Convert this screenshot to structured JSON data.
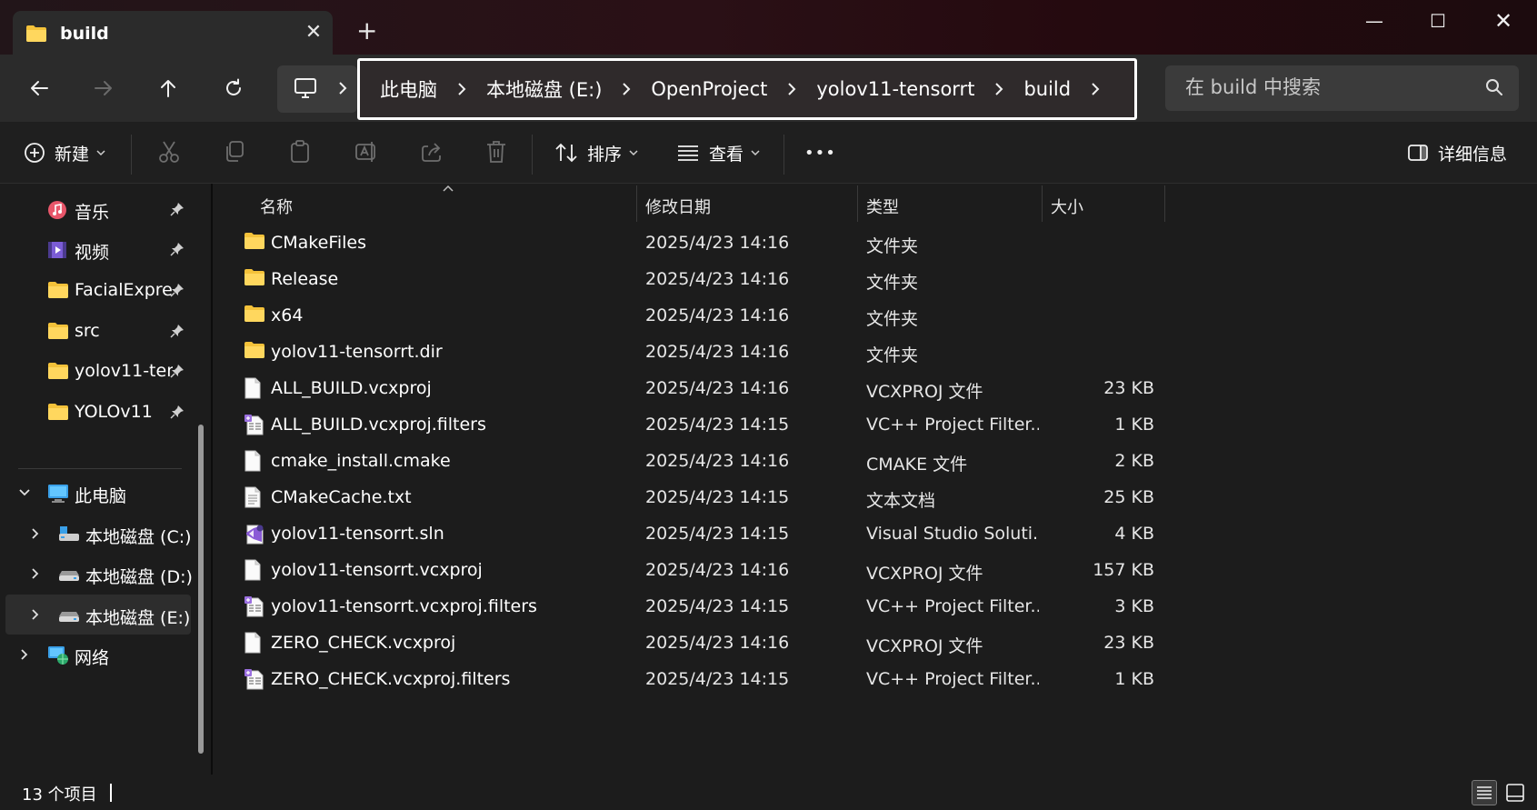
{
  "tab": {
    "title": "build",
    "close": "✕",
    "new": "+"
  },
  "window": {
    "minimize": "—",
    "maximize": "☐",
    "close": "✕"
  },
  "address": {
    "crumbs": [
      "此电脑",
      "本地磁盘 (E:)",
      "OpenProject",
      "yolov11-tensorrt",
      "build"
    ]
  },
  "search": {
    "placeholder": "在 build 中搜索"
  },
  "toolbar": {
    "new_label": "新建",
    "sort_label": "排序",
    "view_label": "查看",
    "more_label": "•••",
    "details_label": "详细信息"
  },
  "sidebar": {
    "quick_access": [
      {
        "label": "音乐",
        "icon": "music-icon"
      },
      {
        "label": "视频",
        "icon": "video-icon"
      },
      {
        "label": "FacialExpres",
        "icon": "folder-icon"
      },
      {
        "label": "src",
        "icon": "folder-icon"
      },
      {
        "label": "yolov11-ten",
        "icon": "folder-icon"
      },
      {
        "label": "YOLOv11",
        "icon": "folder-icon"
      }
    ],
    "this_pc": "此电脑",
    "drives": [
      "本地磁盘 (C:)",
      "本地磁盘 (D:)",
      "本地磁盘 (E:)"
    ],
    "network": "网络"
  },
  "columns": {
    "name": "名称",
    "date": "修改日期",
    "type": "类型",
    "size": "大小"
  },
  "files": [
    {
      "name": "CMakeFiles",
      "date": "2025/4/23 14:16",
      "type": "文件夹",
      "size": "",
      "icon": "folder"
    },
    {
      "name": "Release",
      "date": "2025/4/23 14:16",
      "type": "文件夹",
      "size": "",
      "icon": "folder"
    },
    {
      "name": "x64",
      "date": "2025/4/23 14:16",
      "type": "文件夹",
      "size": "",
      "icon": "folder"
    },
    {
      "name": "yolov11-tensorrt.dir",
      "date": "2025/4/23 14:16",
      "type": "文件夹",
      "size": "",
      "icon": "folder"
    },
    {
      "name": "ALL_BUILD.vcxproj",
      "date": "2025/4/23 14:16",
      "type": "VCXPROJ 文件",
      "size": "23 KB",
      "icon": "file"
    },
    {
      "name": "ALL_BUILD.vcxproj.filters",
      "date": "2025/4/23 14:15",
      "type": "VC++ Project Filter...",
      "size": "1 KB",
      "icon": "filters"
    },
    {
      "name": "cmake_install.cmake",
      "date": "2025/4/23 14:16",
      "type": "CMAKE 文件",
      "size": "2 KB",
      "icon": "file"
    },
    {
      "name": "CMakeCache.txt",
      "date": "2025/4/23 14:15",
      "type": "文本文档",
      "size": "25 KB",
      "icon": "text"
    },
    {
      "name": "yolov11-tensorrt.sln",
      "date": "2025/4/23 14:15",
      "type": "Visual Studio Soluti...",
      "size": "4 KB",
      "icon": "sln"
    },
    {
      "name": "yolov11-tensorrt.vcxproj",
      "date": "2025/4/23 14:16",
      "type": "VCXPROJ 文件",
      "size": "157 KB",
      "icon": "file"
    },
    {
      "name": "yolov11-tensorrt.vcxproj.filters",
      "date": "2025/4/23 14:15",
      "type": "VC++ Project Filter...",
      "size": "3 KB",
      "icon": "filters"
    },
    {
      "name": "ZERO_CHECK.vcxproj",
      "date": "2025/4/23 14:16",
      "type": "VCXPROJ 文件",
      "size": "23 KB",
      "icon": "file"
    },
    {
      "name": "ZERO_CHECK.vcxproj.filters",
      "date": "2025/4/23 14:15",
      "type": "VC++ Project Filter...",
      "size": "1 KB",
      "icon": "filters"
    }
  ],
  "status": {
    "count": "13 个项目"
  },
  "colors": {
    "folder": "#f4c23a",
    "accent": "#4cc2ff",
    "titlebar": "#2a1016",
    "highlight_border": "#ffffff"
  }
}
